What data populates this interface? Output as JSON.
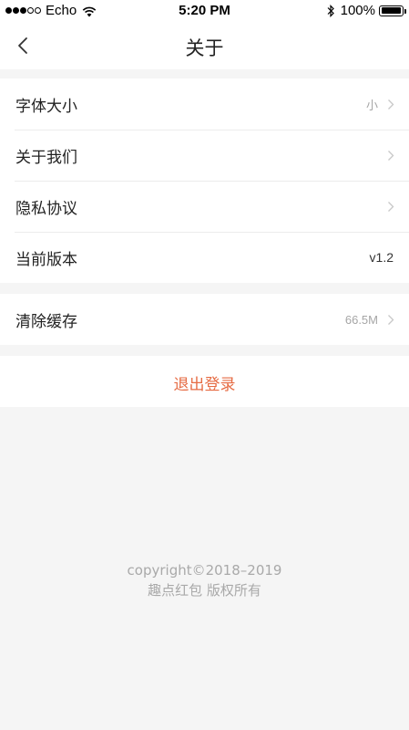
{
  "status_bar": {
    "carrier": "Echo",
    "time": "5:20 PM",
    "battery": "100%",
    "signal_icon": "signal-dots-icon",
    "wifi_icon": "wifi-icon",
    "bluetooth_icon": "bluetooth-icon",
    "battery_level": 1.0
  },
  "nav": {
    "title": "关于",
    "back_icon": "chevron-left-icon"
  },
  "settings": {
    "items": [
      {
        "label": "字体大小",
        "value": "小"
      },
      {
        "label": "关于我们",
        "value": ""
      },
      {
        "label": "隐私协议",
        "value": ""
      },
      {
        "label": "当前版本",
        "value": "v1.2"
      }
    ]
  },
  "cache": {
    "label": "清除缓存",
    "value": "66.5M"
  },
  "logout": {
    "label": "退出登录",
    "color": "#e66b43"
  },
  "footer": {
    "copyright": "copyright©2018–2019",
    "owner": "趣点红包 版权所有"
  }
}
